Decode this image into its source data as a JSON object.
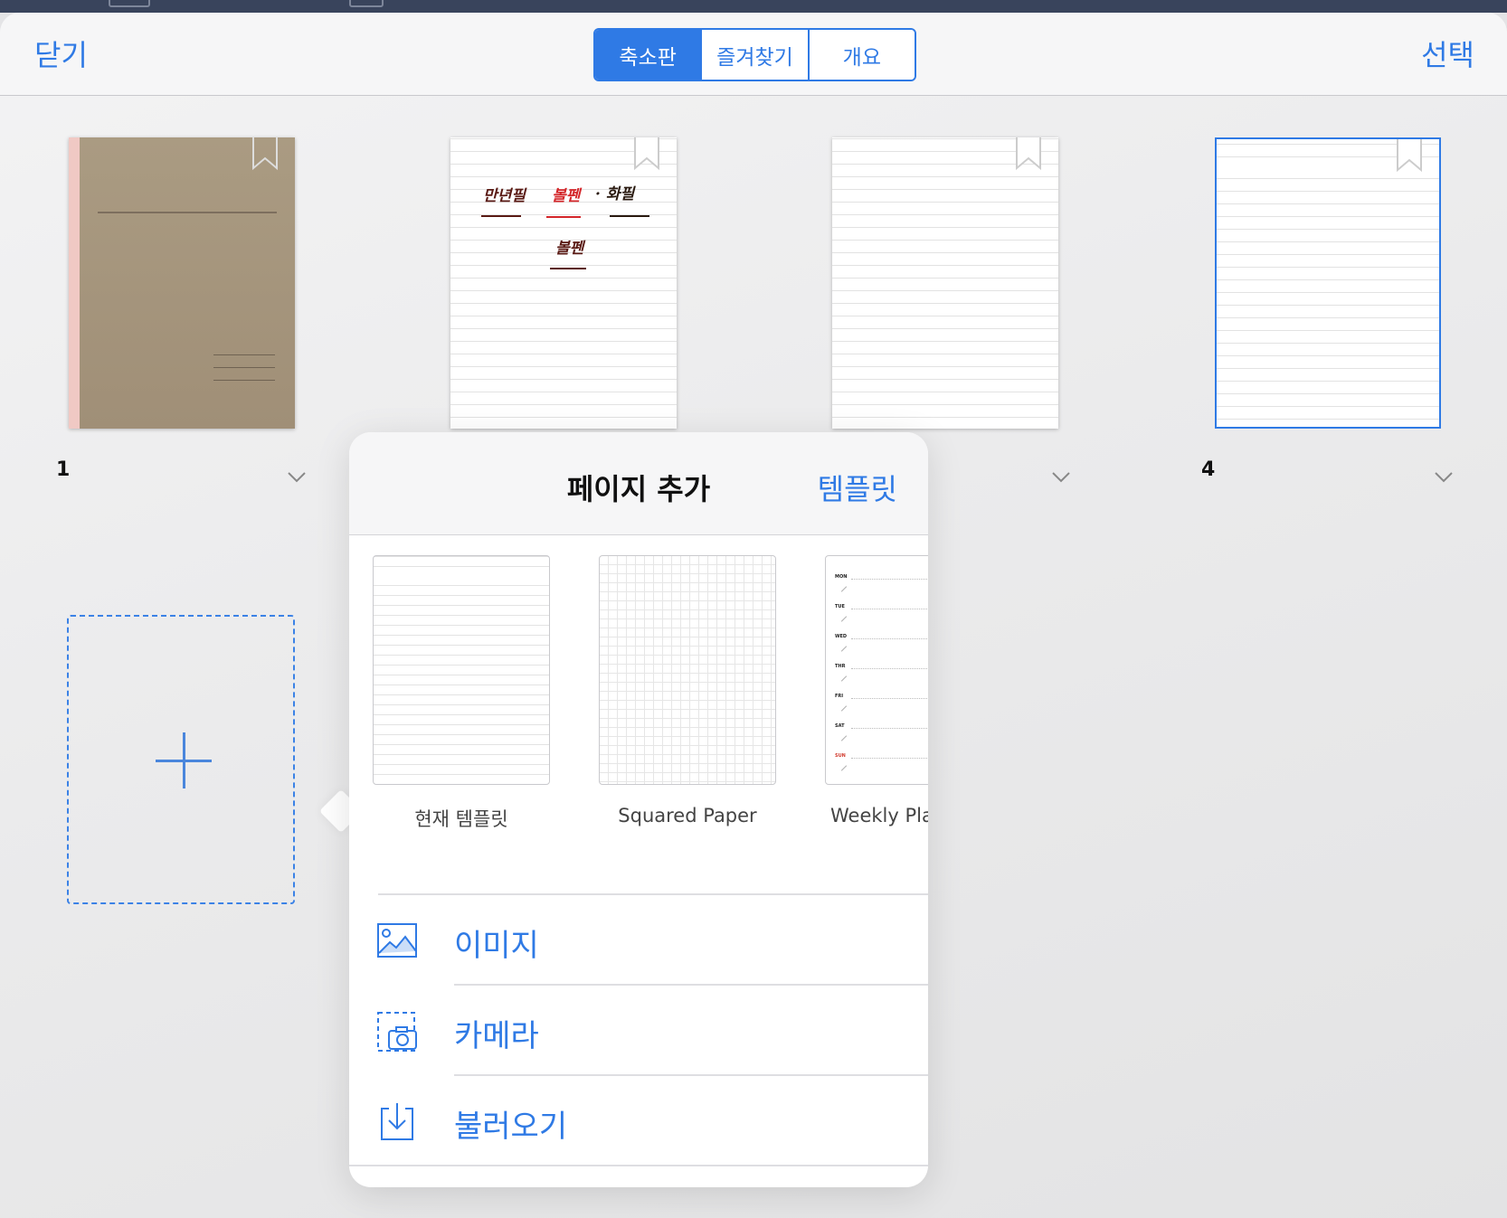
{
  "nav": {
    "close_label": "닫기",
    "select_label": "선택",
    "tabs": [
      {
        "label": "축소판",
        "active": true
      },
      {
        "label": "즐겨찾기",
        "active": false
      },
      {
        "label": "개요",
        "active": false
      }
    ]
  },
  "pages": [
    {
      "number": "1",
      "kind": "cover"
    },
    {
      "number": "",
      "kind": "handwritten"
    },
    {
      "number": "",
      "kind": "lined"
    },
    {
      "number": "4",
      "kind": "lined",
      "selected": true
    }
  ],
  "handwriting": {
    "word1": "만년필",
    "word2": "볼펜",
    "word3": "· 화필",
    "word4": "볼펜"
  },
  "popover": {
    "title": "페이지 추가",
    "template_link": "템플릿",
    "templates": [
      {
        "label": "현재 템플릿",
        "style": "lined"
      },
      {
        "label": "Squared Paper",
        "style": "grid"
      },
      {
        "label": "Weekly Pla",
        "style": "weekly"
      }
    ],
    "weekly_days": [
      "MON",
      "TUE",
      "WED",
      "THR",
      "FRI",
      "SAT",
      "SUN"
    ],
    "actions": [
      {
        "label": "이미지",
        "icon": "image-icon"
      },
      {
        "label": "카메라",
        "icon": "camera-icon"
      },
      {
        "label": "불러오기",
        "icon": "import-icon"
      }
    ]
  },
  "colors": {
    "accent": "#2f7ae5",
    "handwriting_dark": "#5a1a14",
    "handwriting_red": "#d4262a",
    "sunday_red": "#d23c2f"
  }
}
